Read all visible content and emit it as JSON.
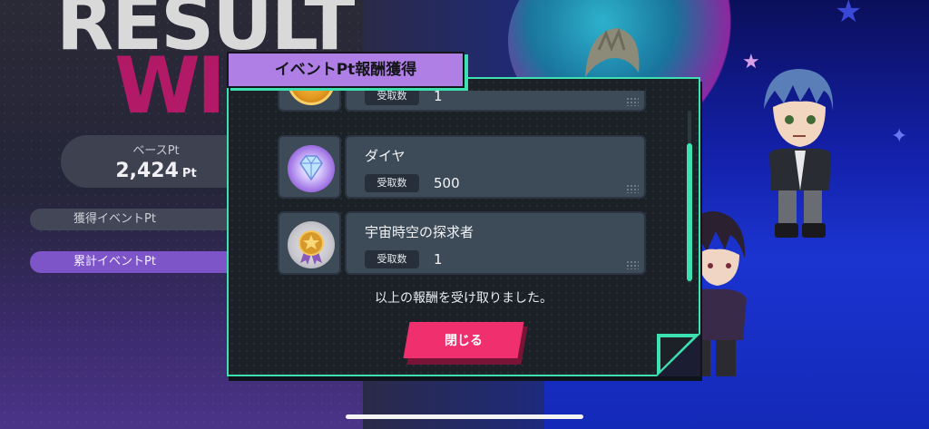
{
  "background": {
    "title": "RESULT",
    "subtitle": "WI",
    "base_points": {
      "label": "ベースPt",
      "value": "2,424",
      "unit": "Pt"
    },
    "earned_label": "獲得イベントPt",
    "total_label": "累計イベントPt"
  },
  "dialog": {
    "title": "イベントPt報酬獲得",
    "items": [
      {
        "name": "",
        "quantity_label": "受取数",
        "quantity": "1",
        "icon": "gold-coin-icon"
      },
      {
        "name": "ダイヤ",
        "quantity_label": "受取数",
        "quantity": "500",
        "icon": "diamond-icon"
      },
      {
        "name": "宇宙時空の探求者",
        "quantity_label": "受取数",
        "quantity": "1",
        "icon": "medal-icon"
      }
    ],
    "message": "以上の報酬を受け取りました。",
    "close_label": "閉じる"
  },
  "colors": {
    "accent": "#3de0b0",
    "header": "#b07fe6",
    "close_button": "#ef2f6e",
    "win_text": "#c2186b"
  }
}
